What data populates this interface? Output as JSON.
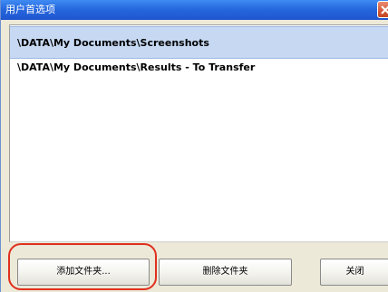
{
  "window": {
    "title": "用户首选项"
  },
  "folders": [
    "\\DATA\\My Documents\\Screenshots",
    "\\DATA\\My Documents\\Results - To Transfer"
  ],
  "buttons": {
    "add_folder": "添加文件夹...",
    "delete_folder": "删除文件夹",
    "close": "关闭"
  },
  "colors": {
    "titlebar": "#2668de",
    "selected_row": "#c6d8f2",
    "highlight_ring": "#e0301e"
  },
  "icons": {
    "close": "close-x-icon"
  },
  "selected_index": 0
}
